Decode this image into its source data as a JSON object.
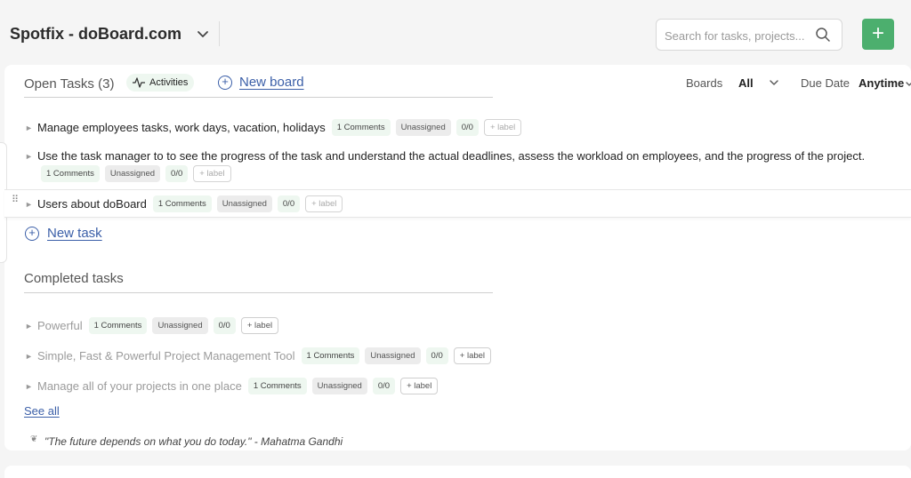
{
  "header": {
    "project_title": "Spotfix - doBoard.com",
    "search_placeholder": "Search for tasks, projects...",
    "add_label": "+"
  },
  "open_tasks": {
    "title": "Open Tasks (3)",
    "activities_label": "Activities",
    "new_board_label": "New board",
    "tasks": [
      {
        "title": "Manage employees tasks, work days, vacation, holidays",
        "comments": "1 Comments",
        "assignee": "Unassigned",
        "count": "0/0",
        "label": "+ label"
      },
      {
        "title": "Use the task manager to to see the progress of the task and understand the actual deadlines, assess the workload on employees, and the progress of the project.",
        "comments": "1 Comments",
        "assignee": "Unassigned",
        "count": "0/0",
        "label": "+ label"
      },
      {
        "title": "Users about doBoard",
        "comments": "1 Comments",
        "assignee": "Unassigned",
        "count": "0/0",
        "label": "+ label"
      }
    ],
    "new_task_label": "New task"
  },
  "filters": {
    "boards_label": "Boards",
    "boards_value": "All",
    "due_label": "Due Date",
    "due_value": "Anytime"
  },
  "completed": {
    "title": "Completed tasks",
    "tasks": [
      {
        "title": "Powerful",
        "comments": "1 Comments",
        "assignee": "Unassigned",
        "count": "0/0",
        "label": "+ label"
      },
      {
        "title": "Simple, Fast & Powerful Project Management Tool",
        "comments": "1 Comments",
        "assignee": "Unassigned",
        "count": "0/0",
        "label": "+ label"
      },
      {
        "title": "Manage all of your projects in one place",
        "comments": "1 Comments",
        "assignee": "Unassigned",
        "count": "0/0",
        "label": "+ label"
      }
    ],
    "see_all_label": "See all"
  },
  "quote": "\"The future depends on what you do today.\" - Mahatma Gandhi",
  "colors": {
    "accent_green": "#4caf6e",
    "link_blue": "#3b5fa8"
  }
}
